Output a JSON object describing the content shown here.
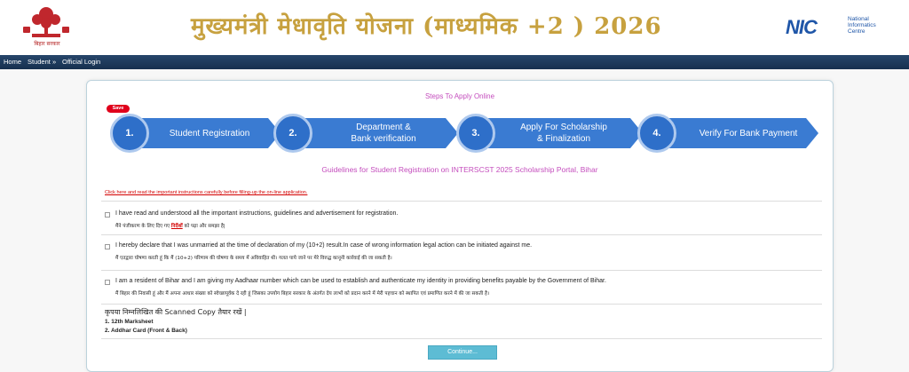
{
  "header": {
    "logo_caption": "बिहार सरकार",
    "title": "मुख्यमंत्री  मेधावृति योजना (माध्यमिक +2 ) 2026",
    "nic_mark": "NIC",
    "nic_text": [
      "National",
      "Informatics",
      "Centre"
    ]
  },
  "nav": {
    "items": [
      "Home",
      "Student »",
      "Official Login"
    ]
  },
  "steps": {
    "title": "Steps To Apply Online",
    "save_badge": "Save",
    "items": [
      {
        "number": "1.",
        "label": "Student Registration"
      },
      {
        "number": "2.",
        "label": "Department &\nBank verification"
      },
      {
        "number": "3.",
        "label": "Apply For Scholarship\n& Finalization"
      },
      {
        "number": "4.",
        "label": "Verify For Bank Payment"
      }
    ]
  },
  "guidelines": {
    "title": "Guidelines for Student Registration on INTERSCST 2025 Scholarship Portal, Bihar",
    "instructions_link": "Click here and read the important instructions carefully before filling-up the on-line application."
  },
  "declarations": [
    {
      "en": "I have read and understood all the important instructions, guidelines and advertisement for registration.",
      "hi_before": "मैंने पंजीकरण के लिए दिए गए ",
      "hi_link": "निर्देशों",
      "hi_after": " को पढ़ा और समझा है|"
    },
    {
      "en": "I hereby declare that I was unmarried at the time of declaration of my (10+2) result.In case of wrong information legal action can be initiated against me.",
      "hi_before": "मैं एतद्वारा घोषणा करती हूं कि मैं (10+2) परिणाम की घोषणा के समय में अविवाहित थी। गलत पाये जाने पर मेरे विरुद्ध कानूनी कार्रवाई की जा सकती है।",
      "hi_link": "",
      "hi_after": ""
    },
    {
      "en": "I am a resident of Bihar and I am giving my Aadhaar number which can be used to establish and authenticate my identity in providing benefits payable by the Government of Bihar.",
      "hi_before": "मैं बिहार की निवासी हूं और मैं अपना आधार संख्या को स्वेच्छापूर्वक दे रही हूं जिसका उपयोग बिहार सरकार के अंतर्गत देय लाभों को प्रदान करने में मेरी पहचान को स्थापित एवं प्रमाणित करने में की जा सकती है।",
      "hi_link": "",
      "hi_after": ""
    }
  ],
  "documents": {
    "heading": "कृपया निम्नलिखित की Scanned Copy तैयार रखें |",
    "items": [
      "1. 12th Marksheet",
      "2. Addhar Card (Front & Back)"
    ]
  },
  "continue_label": "Continue...",
  "colors": {
    "nav": "#1f3a5c",
    "step_blue": "#3a7bd2",
    "accent_pink": "#c44dbd",
    "title_gold": "#c7a13f",
    "link_red": "#d30000",
    "button": "#5dbcd4"
  }
}
